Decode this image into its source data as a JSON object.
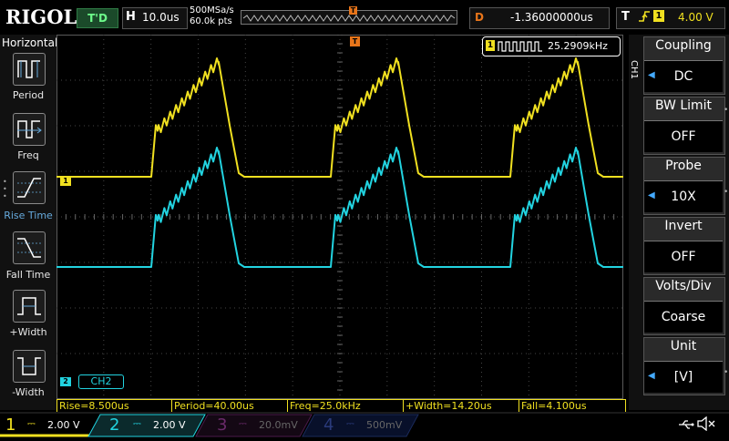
{
  "brand": "RIGOL",
  "status": "T'D",
  "timebase": {
    "mode": "H",
    "value": "10.0us"
  },
  "acquisition": {
    "sample_rate": "500MSa/s",
    "memory_depth": "60.0k pts"
  },
  "memory_marker": "T",
  "delay": {
    "label": "D",
    "value": "-1.36000000us"
  },
  "trigger": {
    "label": "T",
    "edge_icon": "rising-edge-icon",
    "source": "1",
    "level": "4.00 V"
  },
  "left_menu": {
    "title": "Horizontal",
    "items": [
      {
        "label": "Period",
        "icon": "period-icon"
      },
      {
        "label": "Freq",
        "icon": "frequency-icon"
      },
      {
        "label": "Rise Time",
        "icon": "rise-time-icon"
      },
      {
        "label": "Fall Time",
        "icon": "fall-time-icon"
      },
      {
        "label": "+Width",
        "icon": "positive-width-icon"
      },
      {
        "label": "-Width",
        "icon": "negative-width-icon"
      }
    ]
  },
  "screen": {
    "ch1_marker": "1",
    "ch2_marker": "2",
    "ch2_label": "CH2",
    "trigger_position_marker": "T",
    "frequency_counter": {
      "source": "1",
      "value": "25.2909kHz"
    }
  },
  "measurements": [
    {
      "label": "Rise=8.500us"
    },
    {
      "label": "Period=40.00us"
    },
    {
      "label": "Freq=25.0kHz"
    },
    {
      "label": "+Width=14.20us"
    },
    {
      "label": "Fall=4.100us"
    }
  ],
  "right_menu": {
    "channel_tab": "CH1",
    "items": [
      {
        "title": "Coupling",
        "value": "DC",
        "has_arrow": true
      },
      {
        "title": "BW Limit",
        "value": "OFF",
        "has_arrow": false
      },
      {
        "title": "Probe",
        "value": "10X",
        "has_arrow": true
      },
      {
        "title": "Invert",
        "value": "OFF",
        "has_arrow": false
      },
      {
        "title": "Volts/Div",
        "value": "Coarse",
        "has_arrow": false
      },
      {
        "title": "Unit",
        "value": "[V]",
        "has_arrow": true
      }
    ]
  },
  "channels": [
    {
      "number": "1",
      "scale": "2.00 V",
      "color": "#f0e020",
      "active": true
    },
    {
      "number": "2",
      "scale": "2.00 V",
      "color": "#22d3e0",
      "active": true
    },
    {
      "number": "3",
      "scale": "20.0mV",
      "color": "#c040c0",
      "active": false
    },
    {
      "number": "4",
      "scale": "500mV",
      "color": "#4070e0",
      "active": false
    }
  ],
  "colors": {
    "ch1": "#f0e020",
    "ch2": "#22d3e0",
    "trigger": "#e8751a",
    "menu_bg": "#111111"
  }
}
